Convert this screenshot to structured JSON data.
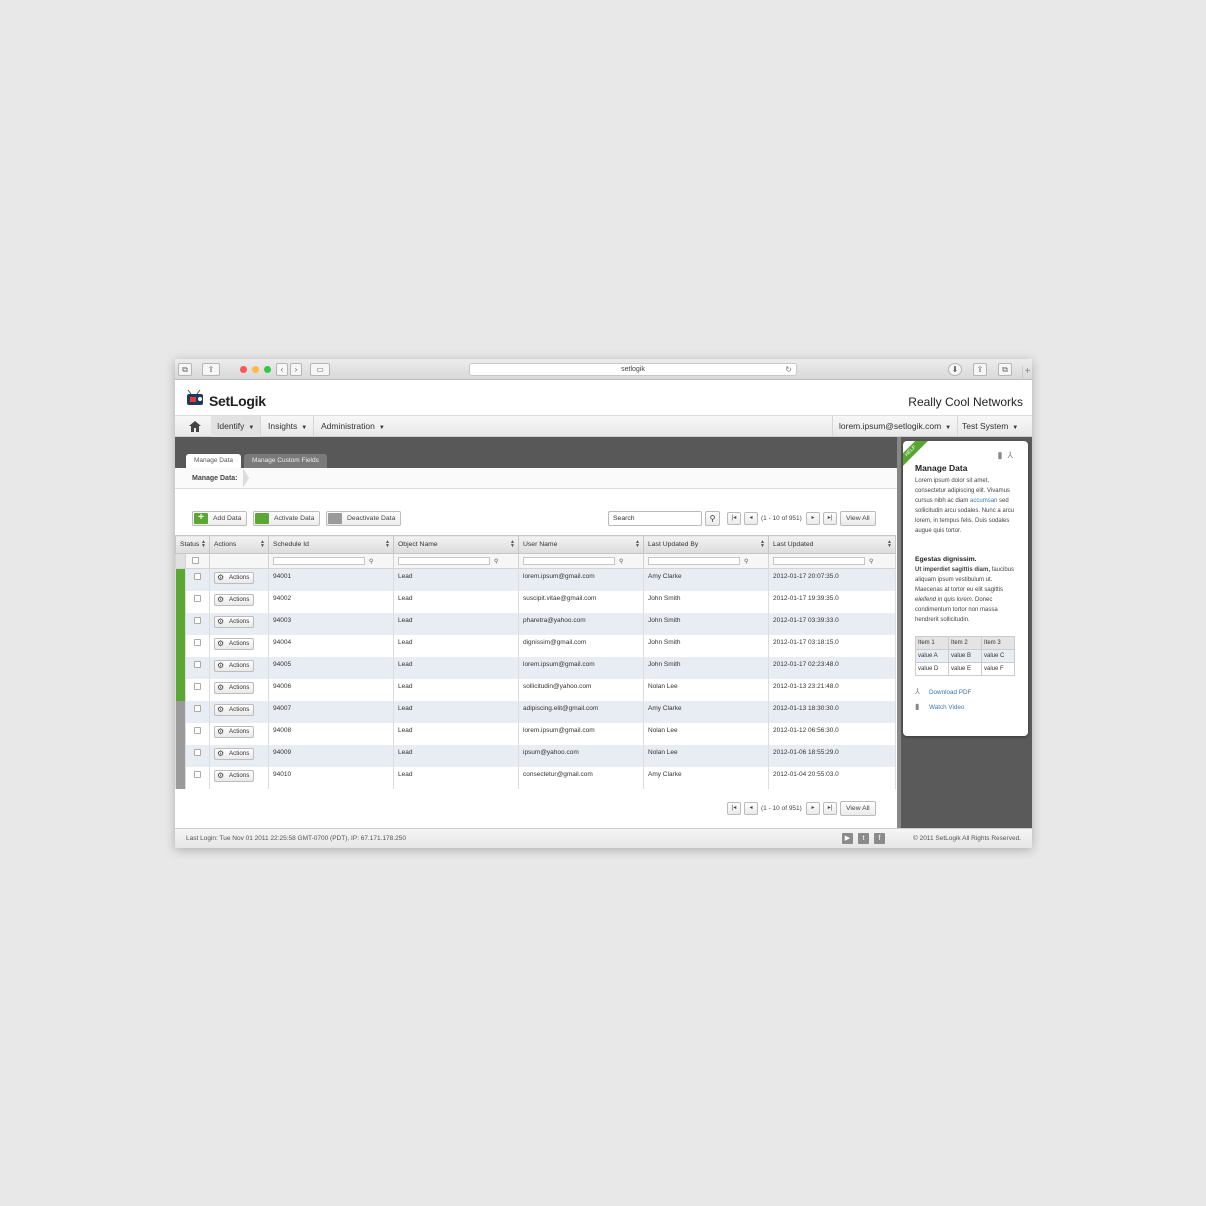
{
  "browser": {
    "url": "setlogik",
    "reload_icon": "↻",
    "back": "‹",
    "forward": "›",
    "new_tab": "+"
  },
  "header": {
    "brand": "SetLogik",
    "org_name": "Really Cool Networks"
  },
  "nav": {
    "home_icon": "home-icon",
    "items": [
      {
        "label": "Identify"
      },
      {
        "label": "Insights"
      },
      {
        "label": "Administration"
      }
    ],
    "user": "lorem.ipsum@setlogik.com",
    "system": "Test System"
  },
  "tabs": [
    {
      "label": "Manage Data",
      "active": true
    },
    {
      "label": "Manage Custom Fields",
      "active": false
    }
  ],
  "breadcrumb": "Manage Data:",
  "toolbar": {
    "add_label": "Add Data",
    "activate_label": "Activate Data",
    "deactivate_label": "Deactivate Data",
    "search_value": "Search",
    "page_range": "(1 - 10 of 951)",
    "view_all": "View All"
  },
  "colors": {
    "active_green": "#5aa734",
    "inactive_gray": "#9a9a9a",
    "link_blue": "#3a77b5"
  },
  "table": {
    "columns": [
      "Status",
      "Actions",
      "Schedule Id",
      "Object Name",
      "User Name",
      "Last Updated By",
      "Last Updated"
    ],
    "action_label": "Actions",
    "rows": [
      {
        "status": "active",
        "id": "94001",
        "object": "Lead",
        "user": "lorem.ipsum@gmail.com",
        "by": "Amy Clarke",
        "updated": "2012-01-17 20:07:35.0"
      },
      {
        "status": "active",
        "id": "94002",
        "object": "Lead",
        "user": "suscipit.vitae@gmail.com",
        "by": "John Smith",
        "updated": "2012-01-17 19:39:35.0"
      },
      {
        "status": "active",
        "id": "94003",
        "object": "Lead",
        "user": "pharetra@yahoo.com",
        "by": "John Smith",
        "updated": "2012-01-17 03:39:33.0"
      },
      {
        "status": "active",
        "id": "94004",
        "object": "Lead",
        "user": "dignissim@gmail.com",
        "by": "John Smith",
        "updated": "2012-01-17 03:18:15.0"
      },
      {
        "status": "active",
        "id": "94005",
        "object": "Lead",
        "user": "lorem.ipsum@gmail.com",
        "by": "John Smith",
        "updated": "2012-01-17 02:23:48.0"
      },
      {
        "status": "active",
        "id": "94006",
        "object": "Lead",
        "user": "sollicitudin@yahoo.com",
        "by": "Nolan Lee",
        "updated": "2012-01-13 23:21:48.0"
      },
      {
        "status": "inactive",
        "id": "94007",
        "object": "Lead",
        "user": "adipiscing.elit@gmail.com",
        "by": "Amy Clarke",
        "updated": "2012-01-13 18:30:30.0"
      },
      {
        "status": "inactive",
        "id": "94008",
        "object": "Lead",
        "user": "lorem.ipsum@gmail.com",
        "by": "Nolan Lee",
        "updated": "2012-01-12 06:56:30.0"
      },
      {
        "status": "inactive",
        "id": "94009",
        "object": "Lead",
        "user": "ipsum@yahoo.com",
        "by": "Nolan Lee",
        "updated": "2012-01-06 18:55:29.0"
      },
      {
        "status": "inactive",
        "id": "94010",
        "object": "Lead",
        "user": "consectetur@gmail.com",
        "by": "Amy Clarke",
        "updated": "2012-01-04 20:55:03.0"
      }
    ]
  },
  "help": {
    "ribbon": "HELP",
    "title": "Manage Data",
    "p1_a": "Lorem ipsum dolor sit amet, consectetur adipiscing elit. Vivamus cursus nibh ac diam ",
    "p1_link": "accumsan",
    "p1_b": " sed sollicitudin arcu sodales. Nunc a arcu lorem, in tempus felis. Duis sodales augue quis tortor.",
    "h2": "Egestas dignissim.",
    "p2_bold": "Ut imperdiet sagittis diam,",
    "p2_a": " faucibus aliquam ipsum vestibulum ut. Maecenas at tortor eu elit sagittis ",
    "p2_em": "eleifend in quis lorem.",
    "p2_b": " Donec condimentum tortor non massa hendrerit sollicitudin.",
    "table_head": [
      "Item 1",
      "Item 2",
      "Item 3"
    ],
    "table_rows": [
      [
        "value A",
        "value B",
        "value C"
      ],
      [
        "value D",
        "value E",
        "value F"
      ]
    ],
    "download_pdf": "Download PDF",
    "watch_video": "Watch Video"
  },
  "footer": {
    "last_login": "Last Login: Tue Nov 01 2011 22:25:58 GMT-0700 (PDT), IP: 67.171.178.250",
    "copyright": "© 2011 SetLogik All Rights Reserved.",
    "social": [
      "youtube-icon",
      "twitter-icon",
      "facebook-icon"
    ]
  }
}
